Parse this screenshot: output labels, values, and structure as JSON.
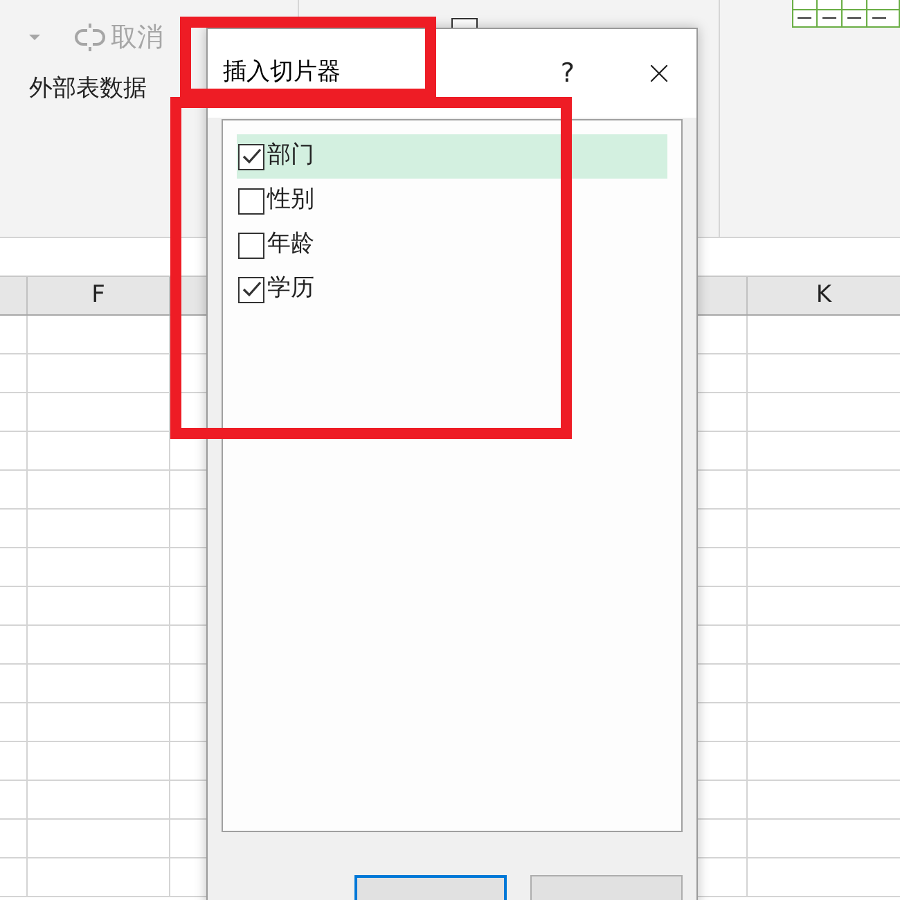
{
  "ribbon": {
    "unlink": {
      "label": "取消",
      "disabled": true
    },
    "group_label": "外部表数据"
  },
  "sheet": {
    "columns": [
      {
        "label": "F"
      },
      {
        "label": "K"
      }
    ]
  },
  "dialog": {
    "title": "插入切片器",
    "help": "?",
    "fields": [
      {
        "label": "部门",
        "checked": true,
        "selected": true
      },
      {
        "label": "性别",
        "checked": false,
        "selected": false
      },
      {
        "label": "年龄",
        "checked": false,
        "selected": false
      },
      {
        "label": "学历",
        "checked": true,
        "selected": false
      }
    ],
    "buttons": [
      {
        "default": true
      },
      {
        "default": false
      }
    ]
  }
}
